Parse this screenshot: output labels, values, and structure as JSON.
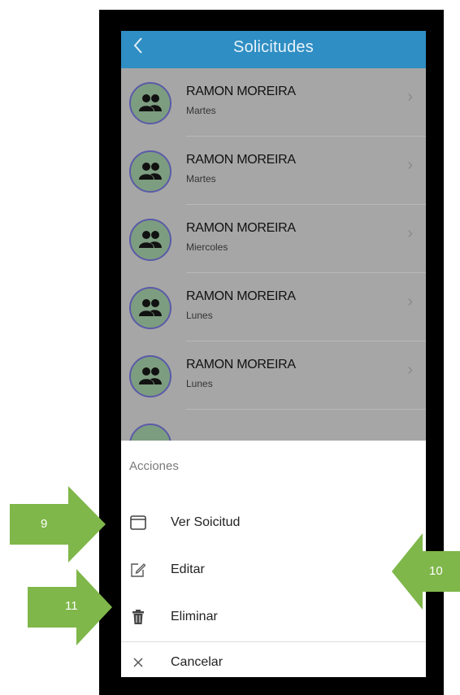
{
  "header": {
    "title": "Solicitudes",
    "back_icon": "chevron-left-icon"
  },
  "requests": [
    {
      "name": "RAMON MOREIRA",
      "day": "Martes"
    },
    {
      "name": "RAMON MOREIRA",
      "day": "Martes"
    },
    {
      "name": "RAMON MOREIRA",
      "day": "Miercoles"
    },
    {
      "name": "RAMON MOREIRA",
      "day": "Lunes"
    },
    {
      "name": "RAMON MOREIRA",
      "day": "Lunes"
    }
  ],
  "action_sheet": {
    "title": "Acciones",
    "actions": [
      {
        "label": "Ver Soicitud",
        "icon": "window-icon"
      },
      {
        "label": "Editar",
        "icon": "edit-icon"
      },
      {
        "label": "Eliminar",
        "icon": "trash-icon"
      },
      {
        "label": "Cancelar",
        "icon": "close-icon"
      }
    ]
  },
  "annotations": [
    {
      "label": "9"
    },
    {
      "label": "10"
    },
    {
      "label": "11"
    }
  ],
  "colors": {
    "header": "#2f8ec3",
    "annotation": "#7fb74a",
    "overlay": "#a6a6a6"
  }
}
